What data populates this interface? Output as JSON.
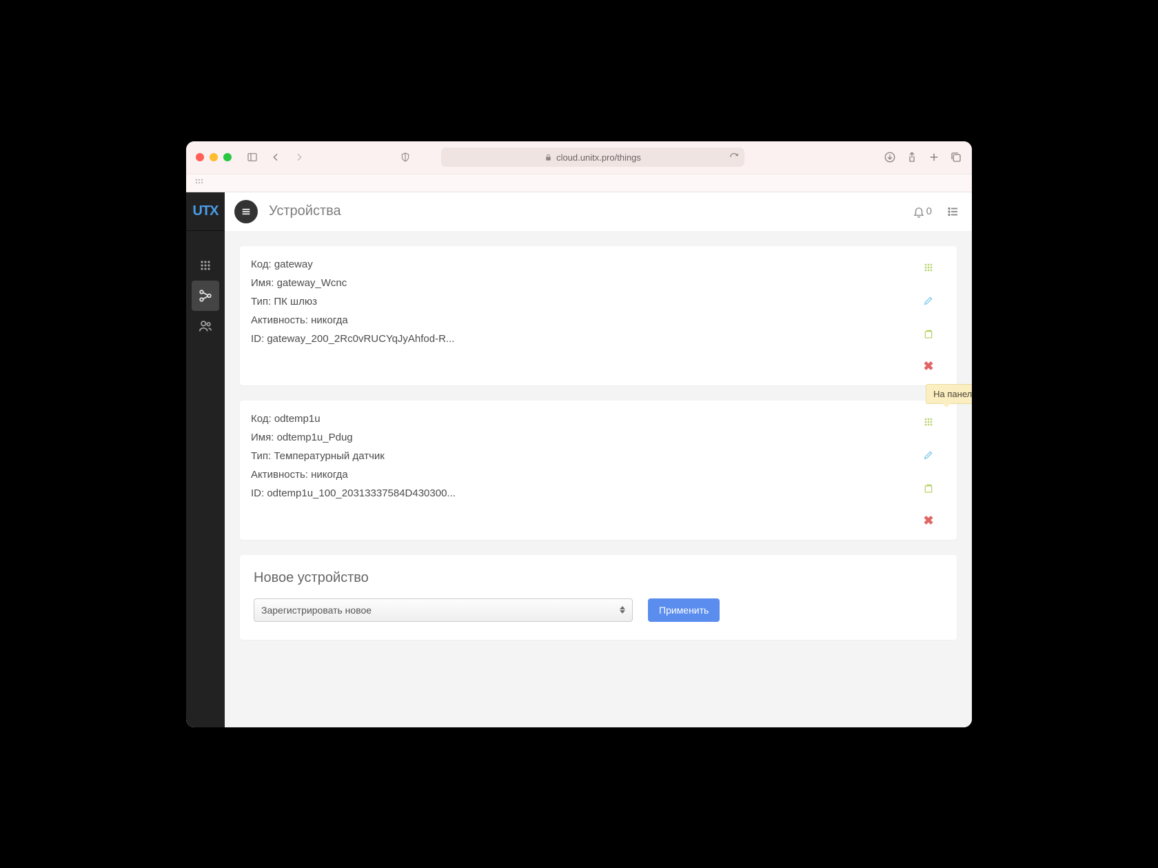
{
  "browser": {
    "url": "cloud.unitx.pro/things"
  },
  "sidebar": {
    "logo": "UTX"
  },
  "header": {
    "title": "Устройства",
    "notification_count": "0"
  },
  "tooltip": {
    "panel": "На панель"
  },
  "devices": [
    {
      "code_label": "Код:",
      "code": "gateway",
      "name_label": "Имя:",
      "name": "gateway_Wcnc",
      "type_label": "Тип:",
      "type": "ПК шлюз",
      "activity_label": "Активность:",
      "activity": "никогда",
      "id_label": "ID:",
      "id": "gateway_200_2Rc0vRUCYqJyAhfod-R..."
    },
    {
      "code_label": "Код:",
      "code": "odtemp1u",
      "name_label": "Имя:",
      "name": "odtemp1u_Pdug",
      "type_label": "Тип:",
      "type": "Температурный датчик",
      "activity_label": "Активность:",
      "activity": "никогда",
      "id_label": "ID:",
      "id": "odtemp1u_100_20313337584D430300..."
    }
  ],
  "new_device": {
    "title": "Новое устройство",
    "select_label": "Зарегистрировать новое",
    "apply": "Применить"
  }
}
